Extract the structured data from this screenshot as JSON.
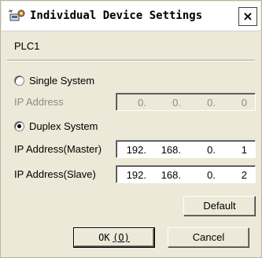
{
  "window": {
    "title": "Individual Device Settings",
    "close_glyph": "×"
  },
  "device": {
    "name": "PLC1"
  },
  "single": {
    "label": "Single System",
    "selected": false,
    "ip_label": "IP Address",
    "ip": [
      "0.",
      "0.",
      "0.",
      "0"
    ]
  },
  "duplex": {
    "label": "Duplex System",
    "selected": true,
    "master_label": "IP Address(Master)",
    "master_ip": [
      "192.",
      "168.",
      "0.",
      "1"
    ],
    "slave_label": "IP Address(Slave)",
    "slave_ip": [
      "192.",
      "168.",
      "0.",
      "2"
    ]
  },
  "buttons": {
    "default_label": "Default",
    "ok_label": "OK",
    "ok_hotkey": "(O)",
    "cancel_label": "Cancel"
  },
  "colors": {
    "dialog_bg": "#ECE9D8",
    "icon": "#3a6ea5"
  },
  "icons": {
    "title": "device-settings-icon",
    "close": "close-icon"
  }
}
